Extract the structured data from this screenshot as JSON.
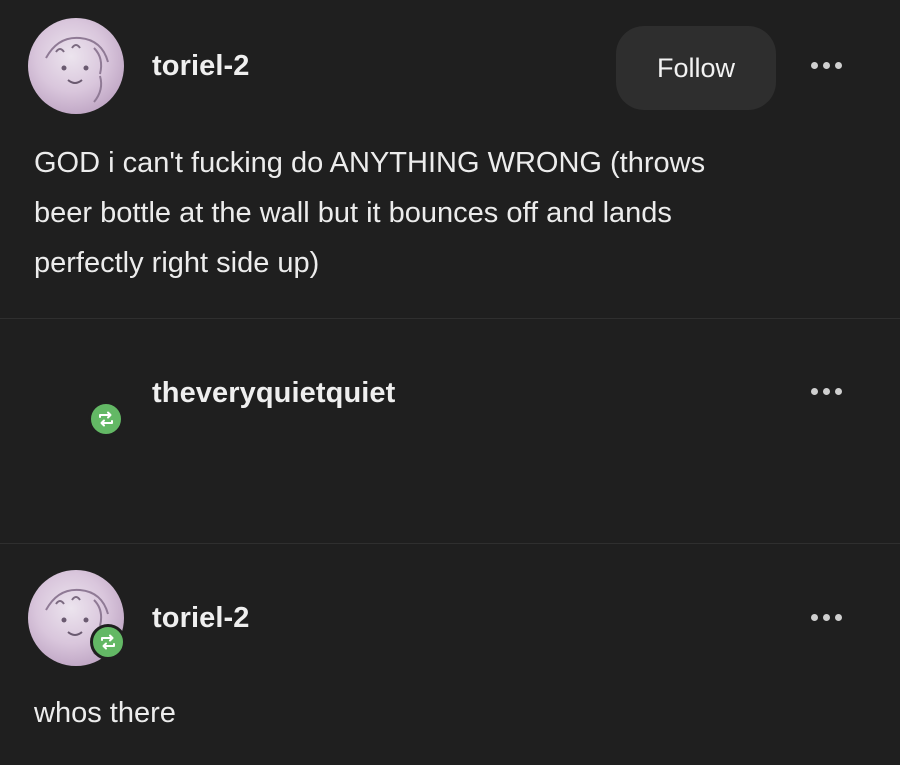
{
  "post": {
    "author": "toriel-2",
    "follow_label": "Follow",
    "text": "GOD i can't fucking do ANYTHING WRONG (throws beer bottle at the wall but it bounces off and lands perfectly right side up)",
    "line1": "GOD i can't fucking do ANYTHING WRONG (throws",
    "line2": "beer bottle at the wall but it bounces off and lands",
    "line3": "perfectly right side up)"
  },
  "reblog_1": {
    "author": "theveryquietquiet",
    "icon": "reblog-icon"
  },
  "reblog_2": {
    "author": "toriel-2",
    "text": "whos there",
    "icon": "reblog-icon"
  },
  "colors": {
    "background": "#1f1f1f",
    "reblog_green": "#63b865",
    "button_bg": "#2e2e2e"
  }
}
